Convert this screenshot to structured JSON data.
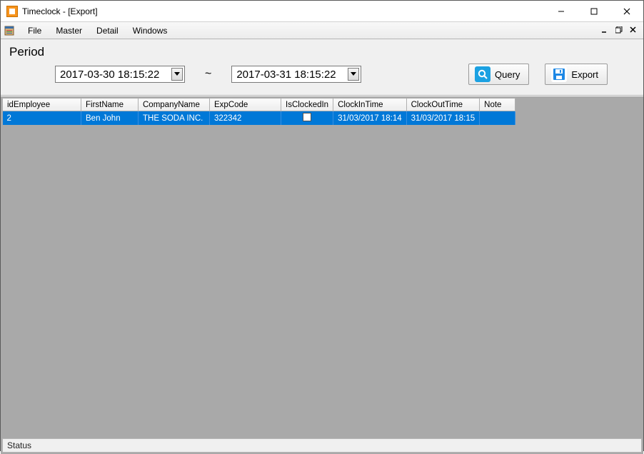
{
  "window": {
    "title": "Timeclock - [Export]"
  },
  "menu": {
    "file": "File",
    "master": "Master",
    "detail": "Detail",
    "windows": "Windows"
  },
  "toolbar": {
    "period_label": "Period",
    "date_from": "2017-03-30 18:15:22",
    "tilde": "~",
    "date_to": "2017-03-31 18:15:22",
    "query_label": "Query",
    "export_label": "Export"
  },
  "grid": {
    "columns": [
      "idEmployee",
      "FirstName",
      "CompanyName",
      "ExpCode",
      "IsClockedIn",
      "ClockInTime",
      "ClockOutTime",
      "Note"
    ],
    "rows": [
      {
        "idEmployee": "2",
        "FirstName": "Ben John",
        "CompanyName": "THE SODA INC.",
        "ExpCode": "322342",
        "IsClockedIn": false,
        "ClockInTime": "31/03/2017 18:14",
        "ClockOutTime": "31/03/2017 18:15",
        "Note": ""
      }
    ]
  },
  "statusbar": {
    "text": "Status"
  }
}
